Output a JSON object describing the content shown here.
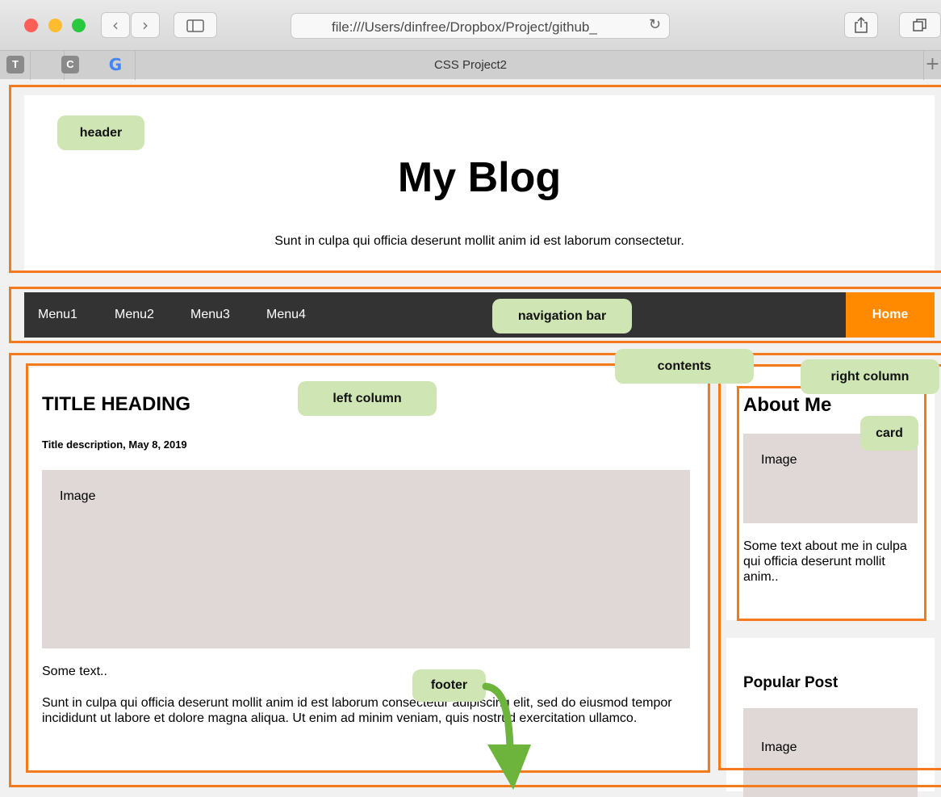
{
  "browser": {
    "url": "file:///Users/dinfree/Dropbox/Project/github_",
    "tab_title": "CSS Project2",
    "favorites": [
      "T",
      "C",
      "G"
    ],
    "back_icon": "‹",
    "forward_icon": "›",
    "reload_icon": "↻",
    "new_tab_icon": "+"
  },
  "page": {
    "header": {
      "title": "My Blog",
      "subtitle": "Sunt in culpa qui officia deserunt mollit anim id est laborum consectetur."
    },
    "nav": {
      "items": [
        "Menu1",
        "Menu2",
        "Menu3",
        "Menu4"
      ],
      "home": "Home"
    },
    "post": {
      "title": "TITLE HEADING",
      "description": "Title description, May 8, 2019",
      "image_label": "Image",
      "text1": "Some text..",
      "text2": "Sunt in culpa qui officia deserunt mollit anim id est laborum consectetur adipiscing elit, sed do eiusmod tempor incididunt ut labore et dolore magna aliqua. Ut enim ad minim veniam, quis nostrud exercitation ullamco."
    },
    "about": {
      "title": "About Me",
      "image_label": "Image",
      "text": "Some text about me in culpa qui officia deserunt mollit anim.."
    },
    "popular": {
      "title": "Popular Post",
      "image_label": "Image"
    }
  },
  "annotations": {
    "header": "header",
    "navigation_bar": "navigation bar",
    "contents": "contents",
    "left_column": "left column",
    "right_column": "right column",
    "card": "card",
    "footer": "footer"
  },
  "colors": {
    "outline": "#f47a1b",
    "tag_bg": "#cfe6b4",
    "arrow": "#6db43c",
    "nav_bg": "#333333",
    "home_bg": "#ff8a00",
    "image_bg": "#e0d7d7"
  }
}
